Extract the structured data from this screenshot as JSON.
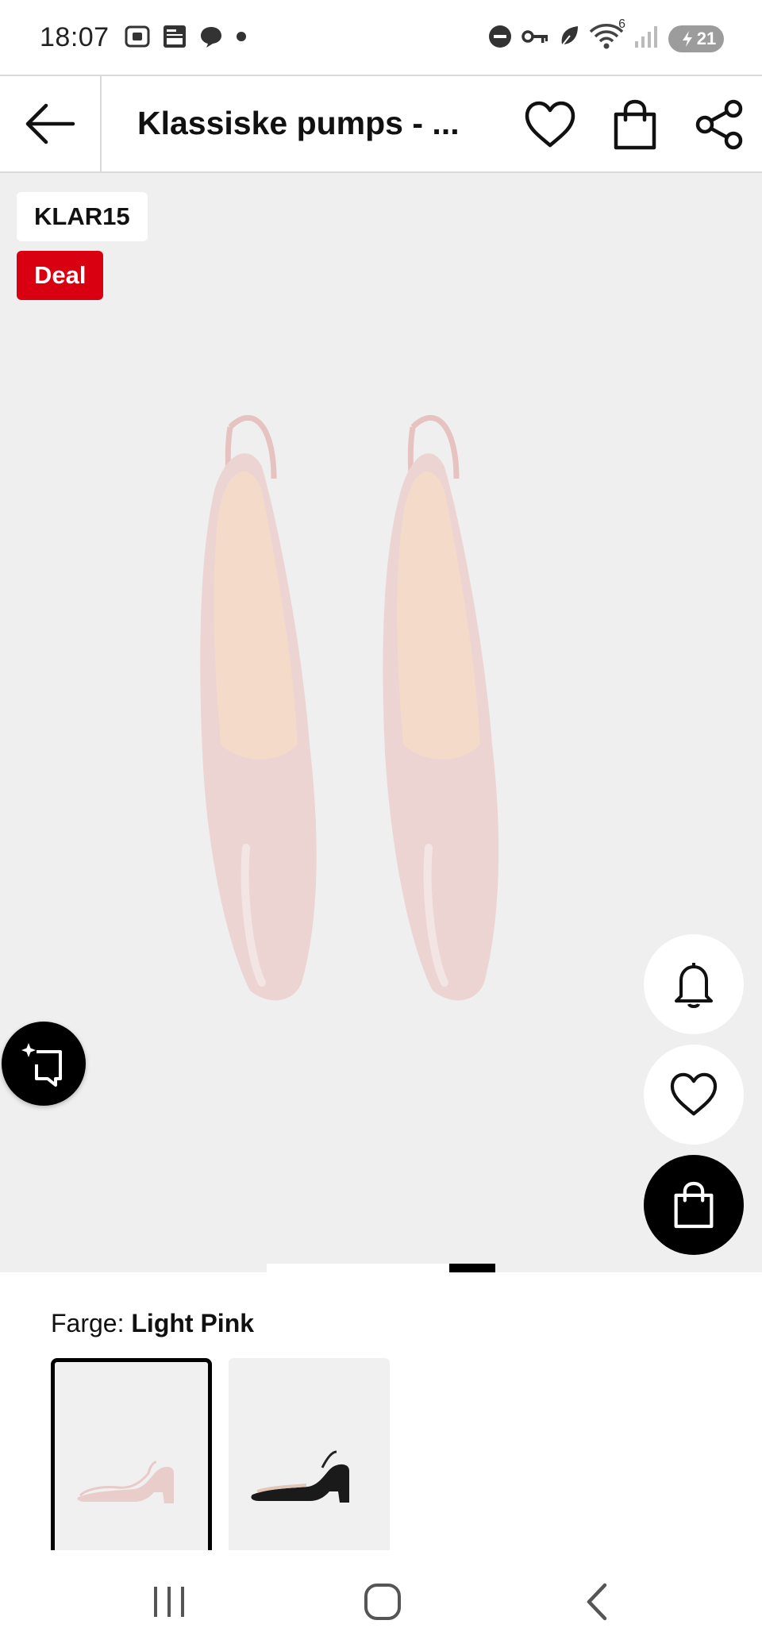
{
  "status_bar": {
    "time": "18:07",
    "battery": "21",
    "network_badge": "6",
    "icons": [
      "screenshot-icon",
      "news-icon",
      "chat-icon",
      "dot-icon",
      "do-not-disturb-icon",
      "vpn-key-icon",
      "leaf-icon",
      "wifi-icon",
      "signal-icon",
      "battery-icon"
    ]
  },
  "header": {
    "title": "Klassiske pumps - ...",
    "icons": [
      "back-arrow-icon",
      "heart-icon",
      "shopping-bag-icon",
      "share-icon"
    ]
  },
  "hero": {
    "code_badge": "KLAR15",
    "deal_badge": "Deal",
    "carousel": {
      "total": 5,
      "active_index": 4
    }
  },
  "color": {
    "label_prefix": "Farge:",
    "selected_color": "Light Pink",
    "swatches": [
      "light-pink-shoe",
      "black-shoe"
    ]
  },
  "nav": {
    "icons": [
      "recents-icon",
      "home-icon",
      "back-icon"
    ]
  },
  "colors": {
    "accent_red": "#d90012",
    "image_bg": "#efefef",
    "shoe_pink": "#e9cfcf",
    "shoe_inner": "#f3d8c6"
  }
}
